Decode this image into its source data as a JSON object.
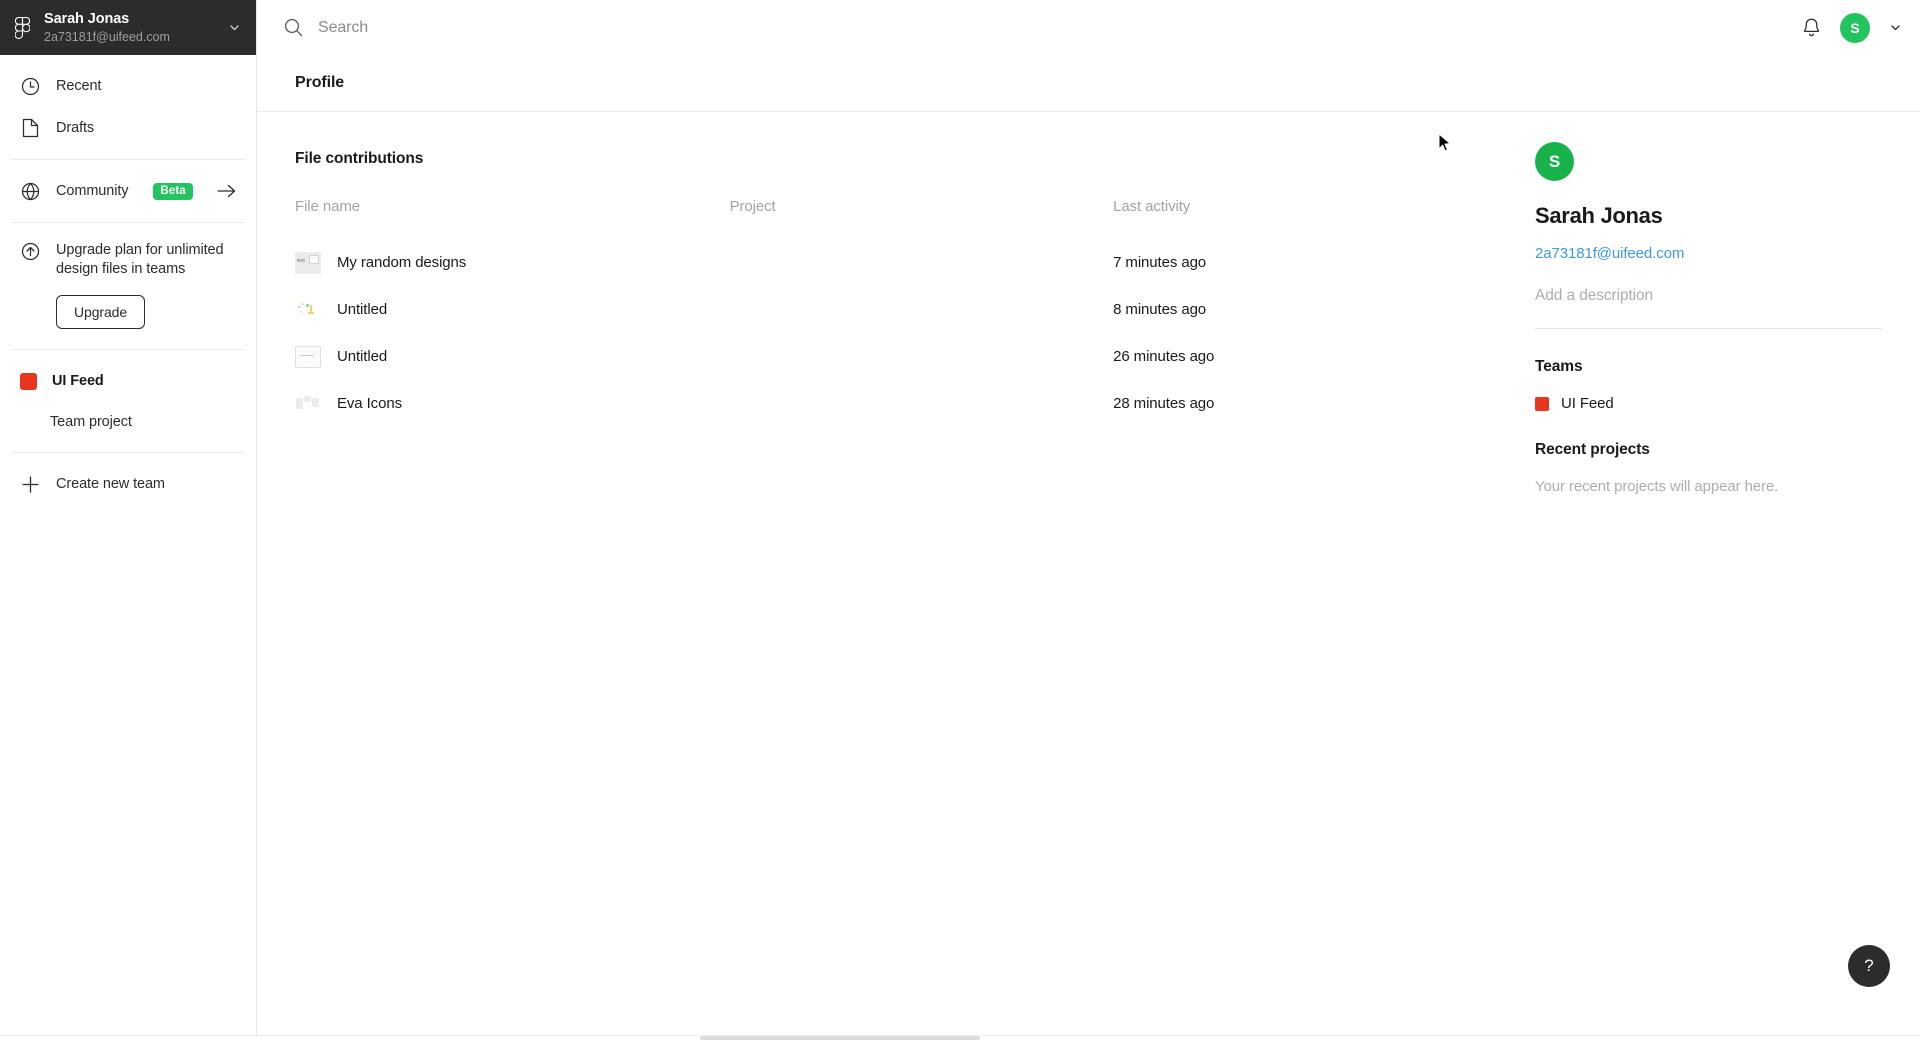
{
  "sidebar": {
    "logo_icon": "figma-logo-icon",
    "user": {
      "name": "Sarah Jonas",
      "email": "2a73181f@uifeed.com",
      "chevron_icon": "chevron-down-icon"
    },
    "nav": [
      {
        "label": "Recent",
        "icon": "clock-icon"
      },
      {
        "label": "Drafts",
        "icon": "file-icon"
      }
    ],
    "community": {
      "label": "Community",
      "badge": "Beta",
      "icon": "globe-icon",
      "arrow_icon": "arrow-right-icon",
      "badge_color": "#21c45d"
    },
    "upgrade": {
      "icon": "arrow-up-circle-icon",
      "text": "Upgrade plan for unlimited design files in teams",
      "button_label": "Upgrade"
    },
    "team": {
      "name": "UI Feed",
      "color": "#e8361e",
      "projects": [
        "Team project"
      ]
    },
    "create_team": {
      "label": "Create new team",
      "icon": "plus-icon"
    }
  },
  "topbar": {
    "search": {
      "placeholder": "Search",
      "value": "",
      "icon": "search-icon"
    },
    "bell_icon": "bell-icon",
    "avatar_initial": "S",
    "avatar_color": "#21c45d",
    "chevron_icon": "chevron-down-icon"
  },
  "page": {
    "title": "Profile"
  },
  "main": {
    "section_title": "File contributions",
    "columns": [
      "File name",
      "Project",
      "Last activity"
    ],
    "rows": [
      {
        "name": "My random designs",
        "project": "",
        "activity": "7 minutes ago",
        "thumb": "thumb-a"
      },
      {
        "name": "Untitled",
        "project": "",
        "activity": "8 minutes ago",
        "thumb": "thumb-b"
      },
      {
        "name": "Untitled",
        "project": "",
        "activity": "26 minutes ago",
        "thumb": "thumb-c"
      },
      {
        "name": "Eva Icons",
        "project": "",
        "activity": "28 minutes ago",
        "thumb": "thumb-d"
      }
    ]
  },
  "profile": {
    "avatar_initial": "S",
    "avatar_color": "#18b24b",
    "name": "Sarah Jonas",
    "email": "2a73181f@uifeed.com",
    "email_color": "#3d9ae0",
    "description_placeholder": "Add a description",
    "teams_heading": "Teams",
    "teams": [
      {
        "name": "UI Feed",
        "color": "#e8361e"
      }
    ],
    "recent_projects_heading": "Recent projects",
    "recent_projects_empty": "Your recent projects will appear here."
  },
  "help": {
    "label": "?"
  }
}
